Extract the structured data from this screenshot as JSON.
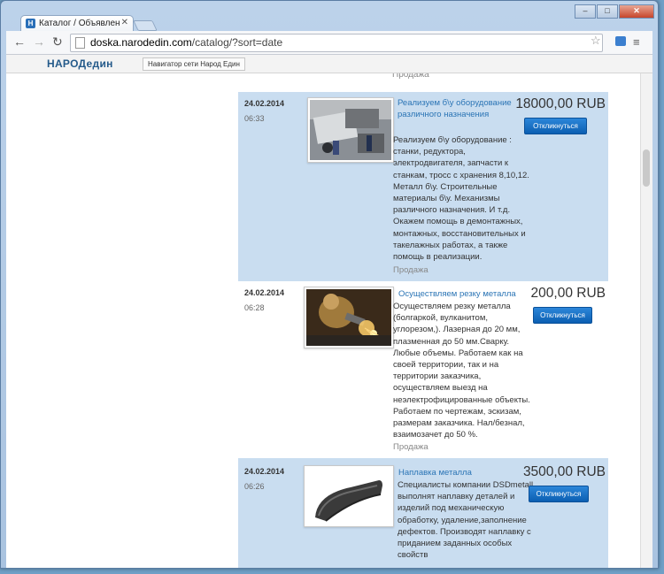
{
  "browser": {
    "tab_title": "Каталог / Объявления в",
    "tab_close": "✕",
    "url_host": "doska.narodedin.com",
    "url_path": "/catalog/?sort=date",
    "back": "←",
    "forward": "→",
    "reload": "↻",
    "star": "☆",
    "menu": "≡",
    "win_min": "–",
    "win_max": "□",
    "win_close": "✕"
  },
  "site": {
    "logo": "НАРОДедин",
    "nav_button": "Навигатор сети Народ Един",
    "partial_category_above": "Продажа"
  },
  "listings": [
    {
      "date": "24.02.2014",
      "time": "06:33",
      "title": "Реализуем б\\у оборудование различного назначения",
      "description": "Реализуем б\\у оборудование : станки, редуктора, электродвигателя, запчасти к станкам, тросс с хранения 8,10,12. Металл б\\у. Строительные материалы б\\у. Механизмы различного назначения. И т.д. Окажем помощь в демонтажных, монтажных, восстановительных и такелажных работах, а также помощь в реализации.",
      "category": "Продажа",
      "price": "18000,00 RUB",
      "button": "Откликнуться",
      "highlighted": true
    },
    {
      "date": "24.02.2014",
      "time": "06:28",
      "title": "Осуществляем резку металла",
      "description": "Осуществляем резку металла (болгаркой, вулканитом, углорезом,). Лазерная до 20 мм, плазменная до 50 мм.Сварку. Любые объемы. Работаем как на своей территории, так и на территории заказчика, осуществляем выезд на неэлектрофицированные объекты. Работаем по чертежам, эскизам, размерам заказчика. Нал/безнал, взаимозачет до 50 %.",
      "category": "Продажа",
      "price": "200,00 RUB",
      "button": "Откликнуться",
      "highlighted": false
    },
    {
      "date": "24.02.2014",
      "time": "06:26",
      "title": "Наплавка металла",
      "description": "Специалисты компании DSDmetall выполнят наплавку деталей и изделий под механическую обработку, удаление,заполнение дефектов. Производят наплавку с приданием заданных особых свойств",
      "category": "",
      "price": "3500,00 RUB",
      "button": "Откликнуться",
      "highlighted": true
    }
  ],
  "colors": {
    "highlight_bg": "#c9ddf0",
    "link": "#2a74b5",
    "button": "#1a6fc4"
  }
}
